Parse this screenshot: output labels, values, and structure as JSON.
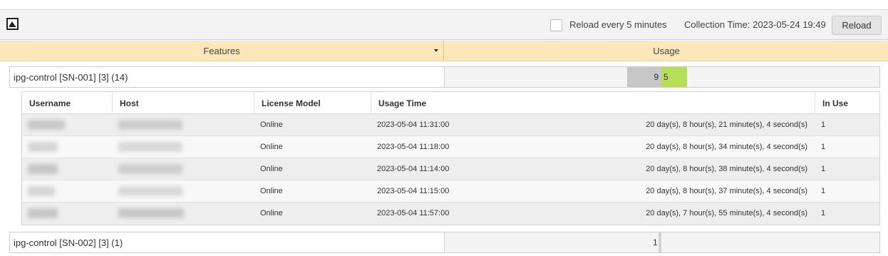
{
  "toolbar": {
    "reload_every_label": "Reload every 5 minutes",
    "reload_every_checked": false,
    "collection_time": "Collection Time: 2023-05-24 19:49",
    "reload_button": "Reload"
  },
  "columns": {
    "features": "Features",
    "usage": "Usage"
  },
  "features": [
    {
      "name": "ipg-control [SN-001] [3] (14)",
      "total": 9,
      "in_use": 5
    },
    {
      "name": "ipg-control [SN-002] [3] (1)",
      "total": 1,
      "in_use": 0
    }
  ],
  "detail": {
    "headers": [
      "Username",
      "Host",
      "License Model",
      "Usage Time",
      "In Use"
    ],
    "rows": [
      {
        "license_model": "Online",
        "usage_time": "2023-05-04 11:31:00",
        "duration": "20 day(s), 8 hour(s), 21 minute(s), 4 second(s)",
        "in_use": "1"
      },
      {
        "license_model": "Online",
        "usage_time": "2023-05-04 11:18:00",
        "duration": "20 day(s), 8 hour(s), 34 minute(s), 4 second(s)",
        "in_use": "1"
      },
      {
        "license_model": "Online",
        "usage_time": "2023-05-04 11:14:00",
        "duration": "20 day(s), 8 hour(s), 38 minute(s), 4 second(s)",
        "in_use": "1"
      },
      {
        "license_model": "Online",
        "usage_time": "2023-05-04 11:15:00",
        "duration": "20 day(s), 8 hour(s), 37 minute(s), 4 second(s)",
        "in_use": "1"
      },
      {
        "license_model": "Online",
        "usage_time": "2023-05-04 11:57:00",
        "duration": "20 day(s), 7 hour(s), 55 minute(s), 4 second(s)",
        "in_use": "1"
      }
    ]
  },
  "colors": {
    "header_bg": "#fde7bb",
    "bar_total": "#c7c7c7",
    "bar_used": "#b5de5b"
  }
}
